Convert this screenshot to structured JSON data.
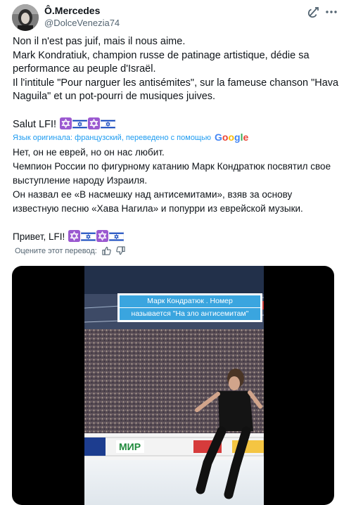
{
  "author": {
    "name": "Ô.Mercedes",
    "handle": "@DolceVenezia74"
  },
  "icons": {
    "grok": "grok-icon",
    "more": "more-dots-icon",
    "flag_il": "israel-flag-icon",
    "thumb_up": "thumb-up-icon",
    "thumb_down": "thumb-down-icon"
  },
  "original": {
    "lines": [
      "Non il n'est pas juif, mais il nous aime.",
      "Mark Kondratiuk, champion russe de patinage artistique, dédie sa",
      "performance au peuple d'Israël.",
      "Il l'intitule \"Pour narguer les antisémites\", sur la fameuse chanson \"Hava",
      "Naguila\" et un pot-pourri de musiques juives."
    ],
    "closing": "Salut LFI!"
  },
  "translation_note": {
    "prefix": "Язык оригинала: французский, переведено с помощью",
    "provider": "Google"
  },
  "translation": {
    "lines": [
      "Нет, он не еврей, но он нас любит.",
      "Чемпион России по фигурному катанию Марк Кондратюк посвятил свое",
      "выступление народу Израиля.",
      "Он назвал ее «В насмешку над антисемитами», взяв за основу",
      "известную песню «Хава Нагила» и попурри из еврейской музыки."
    ],
    "closing": "Привет, LFI!"
  },
  "rating": {
    "label": "Оцените этот перевод:"
  },
  "media": {
    "caption_line1": "Марк Кондратюк . Номер",
    "caption_line2": "называется \"На зло антисемитам\"",
    "banner_text": "МИР"
  },
  "colors": {
    "text": "#0f1419",
    "secondary": "#536471",
    "link": "#1d9bf0",
    "caption_bg": "#3aa5df"
  }
}
